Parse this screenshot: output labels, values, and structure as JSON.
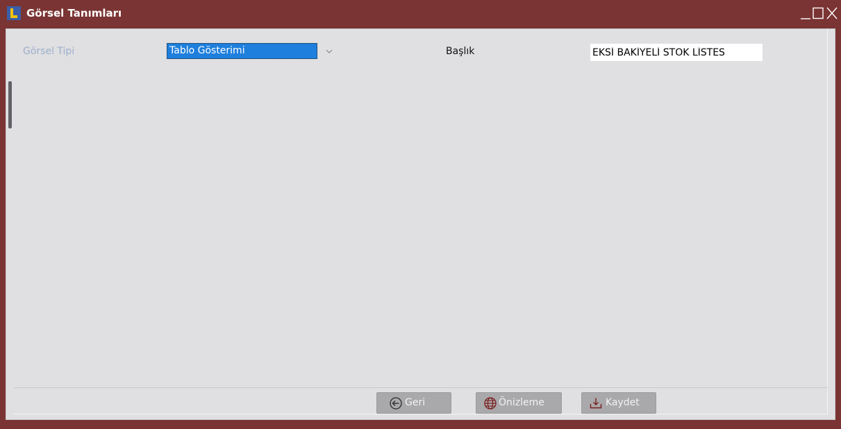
{
  "window": {
    "title": "Görsel Tanımları",
    "icon": "app-logo-icon",
    "controls": {
      "minimize_icon": "minimize-icon",
      "maximize_icon": "maximize-icon",
      "close_icon": "close-icon"
    },
    "colors": {
      "frame": "#7a3433",
      "client_bg": "#e0dfe1",
      "selection": "#1e7fdd",
      "button_bg": "#a9a8aa"
    }
  },
  "form": {
    "visual_type_label": "Görsel Tipi",
    "visual_type_value": "Tablo Gösterimi",
    "title_label": "Başlık",
    "title_value": "EKSİ BAKİYELİ STOK LİSTES"
  },
  "footer": {
    "back_label": "Geri",
    "back_icon": "arrow-left-circle-icon",
    "preview_label": "Önizleme",
    "preview_icon": "globe-icon",
    "save_label": "Kaydet",
    "save_icon": "download-icon"
  }
}
